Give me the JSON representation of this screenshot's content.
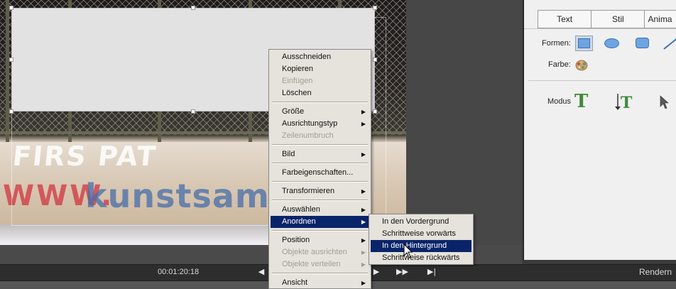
{
  "timeline": {
    "timecode": "00:01:20:18",
    "render_label": "Rendern",
    "buttons": [
      "step-back-icon",
      "play-icon",
      "step-forward-icon",
      "goto-end-icon"
    ]
  },
  "panel": {
    "tabs": [
      {
        "label": "Text"
      },
      {
        "label": "Stil"
      },
      {
        "label": "Anima"
      }
    ],
    "shapes_label": "Formen:",
    "color_label": "Farbe:",
    "mode_label": "Modus"
  },
  "context_menu": {
    "items": [
      {
        "label": "Ausschneiden",
        "enabled": true,
        "submenu": false
      },
      {
        "label": "Kopieren",
        "enabled": true,
        "submenu": false
      },
      {
        "label": "Einfügen",
        "enabled": false,
        "submenu": false
      },
      {
        "label": "Löschen",
        "enabled": true,
        "submenu": false
      },
      {
        "label": "Größe",
        "enabled": true,
        "submenu": true
      },
      {
        "label": "Ausrichtungstyp",
        "enabled": true,
        "submenu": true
      },
      {
        "label": "Zeilenumbruch",
        "enabled": false,
        "submenu": false
      },
      {
        "label": "Bild",
        "enabled": true,
        "submenu": true
      },
      {
        "label": "Farbeigenschaften...",
        "enabled": true,
        "submenu": false
      },
      {
        "label": "Transformieren",
        "enabled": true,
        "submenu": true
      },
      {
        "label": "Auswählen",
        "enabled": true,
        "submenu": true
      },
      {
        "label": "Anordnen",
        "enabled": true,
        "submenu": true,
        "selected": true
      },
      {
        "label": "Position",
        "enabled": true,
        "submenu": true
      },
      {
        "label": "Objekte ausrichten",
        "enabled": false,
        "submenu": true
      },
      {
        "label": "Objekte verteilen",
        "enabled": false,
        "submenu": true
      },
      {
        "label": "Ansicht",
        "enabled": true,
        "submenu": true
      }
    ]
  },
  "submenu": {
    "items": [
      {
        "label": "In den Vordergrund"
      },
      {
        "label": "Schrittweise vorwärts"
      },
      {
        "label": "In den Hintergrund",
        "selected": true
      },
      {
        "label": "Schrittweise rückwärts"
      }
    ]
  },
  "video": {
    "graffiti_line1": "FIRS  PAT",
    "graffiti_line2": "WWW.",
    "graffiti_line3": "kunstsammle"
  },
  "colors": {
    "menu_highlight": "#0a246a",
    "panel_bg": "#f0f0f0",
    "shape_fill": "#6ea4e0",
    "mode_icon": "#3f8a3a"
  }
}
